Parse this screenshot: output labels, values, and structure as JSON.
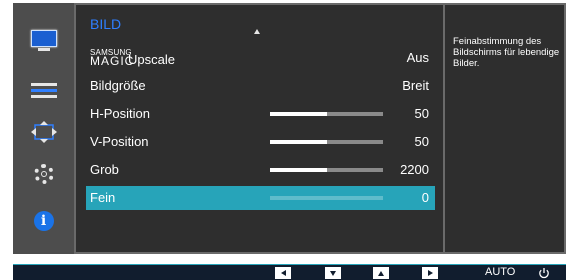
{
  "sidebar": {
    "icons": [
      {
        "name": "picture-menu-icon",
        "selected": true
      },
      {
        "name": "onscreen-display-icon"
      },
      {
        "name": "position-resize-icon"
      },
      {
        "name": "settings-gear-icon"
      },
      {
        "name": "information-icon"
      }
    ]
  },
  "menu": {
    "title": "BILD",
    "items": [
      {
        "label_brand_small": "SAMSUNG",
        "label_brand_large": "MAGIC",
        "label": "Upscale",
        "value": "Aus"
      },
      {
        "label": "Bildgröße",
        "value": "Breit"
      },
      {
        "label": "H-Position",
        "value": "50",
        "level": 0.5
      },
      {
        "label": "V-Position",
        "value": "50",
        "level": 0.5
      },
      {
        "label": "Grob",
        "value": "2200",
        "level": 0.5
      },
      {
        "label": "Fein",
        "value": "0",
        "level": 0,
        "selected": true
      }
    ]
  },
  "help": {
    "text": "Feinabstimmung des Bildschirms für lebendige Bilder."
  },
  "buttons": {
    "left": "left-arrow-icon",
    "down": "down-arrow-icon",
    "up": "up-arrow-icon",
    "enter": "enter-right-arrow-icon",
    "auto": "AUTO",
    "power": "power-icon"
  },
  "colors": {
    "accent_selected_row": "#27a4b9",
    "title_blue": "#2f7fff",
    "info_blue": "#1a73e8"
  }
}
